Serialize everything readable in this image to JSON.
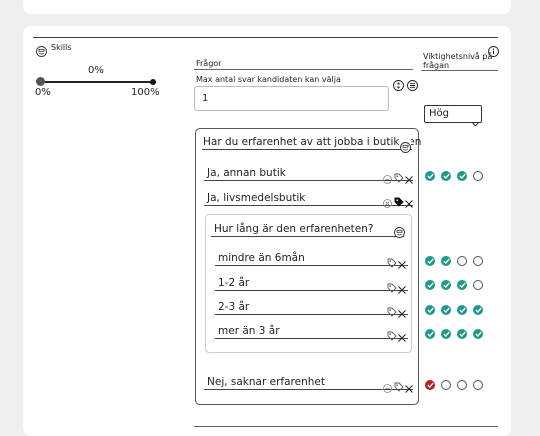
{
  "skills": {
    "header": "Skills",
    "slider": {
      "value_label": "0%",
      "min_label": "0%",
      "max_label": "100%",
      "value": 0
    }
  },
  "questions": {
    "header": "Frågor",
    "max_answers_label": "Max antal svar kandidaten kan välja",
    "max_answers_value": "1"
  },
  "importance": {
    "header_line1": "Viktighetsnivå på",
    "header_line2": "frågan",
    "select_value": "Hög"
  },
  "question1": {
    "text": "Har du erfarenhet av att jobba i butik sen",
    "answers": [
      {
        "label": "Ja, annan butik",
        "levels": [
          true,
          true,
          true,
          false
        ],
        "tag_filled": false
      },
      {
        "label": "Ja, livsmedelsbutik",
        "levels": null,
        "tag_filled": true
      },
      {
        "label": "Nej, saknar erfarenhet",
        "levels": [
          "red",
          false,
          false,
          false
        ],
        "tag_filled": false
      }
    ]
  },
  "question2": {
    "text": "Hur lång är den erfarenheten?",
    "answers": [
      {
        "label": "mindre än 6mån",
        "levels": [
          true,
          true,
          false,
          false
        ]
      },
      {
        "label": "1-2 år",
        "levels": [
          true,
          true,
          true,
          false
        ]
      },
      {
        "label": "2-3 år",
        "levels": [
          true,
          true,
          true,
          true
        ]
      },
      {
        "label": "mer än 3 år",
        "levels": [
          true,
          true,
          true,
          true
        ]
      }
    ]
  },
  "colors": {
    "accent": "#1b9a8c",
    "negative": "#b32121"
  },
  "icons": {
    "skills": "emoji-icon",
    "info": "info-icon",
    "sort": "sort-arrows-icon",
    "list": "list-icon",
    "tag": "tag-icon",
    "remove": "close-icon",
    "chevron": "chevron-down-icon"
  }
}
